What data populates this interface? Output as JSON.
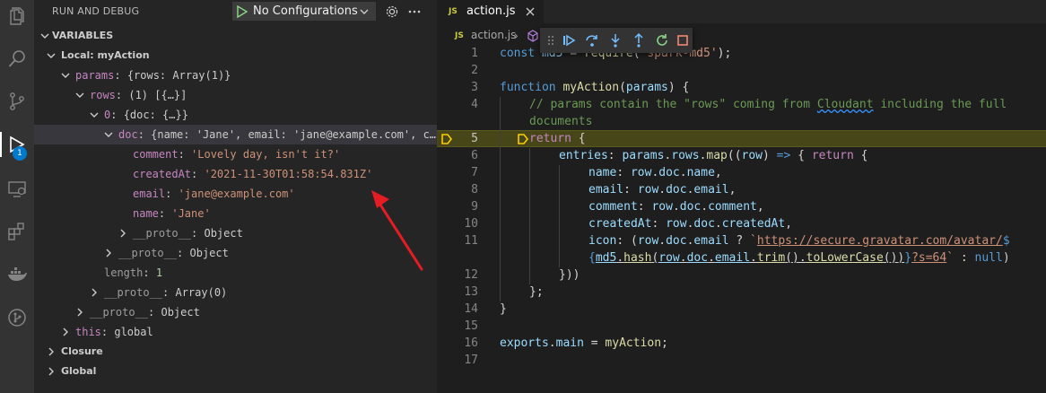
{
  "run_debug": {
    "title": "RUN AND DEBUG",
    "config_label": "No Configurations",
    "debug_badge": "1"
  },
  "variables": {
    "section_label": "VARIABLES",
    "scope_local": "Local: myAction",
    "rows": [
      {
        "name": "params",
        "sep": ": ",
        "value": "{rows: Array(1)}",
        "kind": "object"
      },
      {
        "name": "rows",
        "sep": ": ",
        "value": "(1) [{…}]",
        "kind": "object"
      },
      {
        "name": "0",
        "sep": ": ",
        "value": "{doc: {…}}",
        "kind": "object"
      },
      {
        "name": "doc",
        "sep": ": ",
        "value": "{name: 'Jane', email: 'jane@example.com', c…",
        "kind": "object"
      },
      {
        "name": "comment",
        "sep": ": ",
        "value": "'Lovely day, isn't it?'",
        "kind": "string"
      },
      {
        "name": "createdAt",
        "sep": ": ",
        "value": "'2021-11-30T01:58:54.831Z'",
        "kind": "string"
      },
      {
        "name": "email",
        "sep": ": ",
        "value": "'jane@example.com'",
        "kind": "string"
      },
      {
        "name": "name",
        "sep": ": ",
        "value": "'Jane'",
        "kind": "string"
      },
      {
        "name": "__proto__",
        "sep": ": ",
        "value": "Object",
        "kind": "object"
      },
      {
        "name": "__proto__",
        "sep": ": ",
        "value": "Object",
        "kind": "object"
      },
      {
        "name": "length",
        "sep": ": ",
        "value": "1",
        "kind": "number"
      },
      {
        "name": "__proto__",
        "sep": ": ",
        "value": "Array(0)",
        "kind": "object"
      },
      {
        "name": "__proto__",
        "sep": ": ",
        "value": "Object",
        "kind": "object"
      },
      {
        "name": "this",
        "sep": ": ",
        "value": "global",
        "kind": "object"
      }
    ],
    "scope_closure": "Closure",
    "scope_global": "Global"
  },
  "editor": {
    "tab_label": "action.js",
    "tab_badge": "JS",
    "breadcrumb_file": "action.js",
    "breadcrumb_sep": "›",
    "current_line": 5,
    "line_numbers": [
      "1",
      "2",
      "3",
      "4",
      "",
      "5",
      "6",
      "7",
      "8",
      "9",
      "10",
      "11",
      "",
      "12",
      "13",
      "14",
      "15",
      "16",
      "17"
    ],
    "code": {
      "l1a": "const ",
      "l1b": "md5",
      "l1c": " = ",
      "l1d": "require",
      "l1e": "(",
      "l1f": "'spark-md5'",
      "l1g": ");",
      "l3a": "function ",
      "l3b": "myAction",
      "l3c": "(",
      "l3d": "params",
      "l3e": ") {",
      "l4a": "// params contain the \"rows\" coming from ",
      "l4b": "Cloudant",
      "l4c": " including the full",
      "l4d": "documents",
      "l5a": "return",
      "l5b": " {",
      "l6a": "entries",
      "l6b": ": ",
      "l6c": "params",
      "l6d": ".",
      "l6e": "rows",
      "l6f": ".",
      "l6g": "map",
      "l6h": "((",
      "l6i": "row",
      "l6j": ") ",
      "l6k": "=>",
      "l6l": " { ",
      "l6m": "return",
      "l6n": " {",
      "l7a": "name",
      "l7b": ": ",
      "l7c": "row",
      "l7d": ".",
      "l7e": "doc",
      "l7f": ".",
      "l7g": "name",
      "l7h": ",",
      "l8a": "email",
      "l8b": ": ",
      "l8c": "row",
      "l8d": ".",
      "l8e": "doc",
      "l8f": ".",
      "l8g": "email",
      "l8h": ",",
      "l9a": "comment",
      "l9b": ": ",
      "l9c": "row",
      "l9d": ".",
      "l9e": "doc",
      "l9f": ".",
      "l9g": "comment",
      "l9h": ",",
      "l10a": "createdAt",
      "l10b": ": ",
      "l10c": "row",
      "l10d": ".",
      "l10e": "doc",
      "l10f": ".",
      "l10g": "createdAt",
      "l10h": ",",
      "l11a": "icon",
      "l11b": ": (",
      "l11c": "row",
      "l11d": ".",
      "l11e": "doc",
      "l11f": ".",
      "l11g": "email",
      "l11h": " ? ",
      "l11i": "`",
      "l11j": "https://secure.gravatar.com/avatar/",
      "l11k": "$",
      "l11w1": "{",
      "l11w2": "md5",
      "l11w3": ".",
      "l11w4": "hash",
      "l11w5": "(",
      "l11w6": "row",
      "l11w7": ".",
      "l11w8": "doc",
      "l11w9": ".",
      "l11w10": "email",
      "l11w11": ".",
      "l11w12": "trim",
      "l11w13": "().",
      "l11w14": "toLowerCase",
      "l11w15": "())",
      "l11w16": "}",
      "l11w17": "?s=64",
      "l11w18": "`",
      "l11w19": " : ",
      "l11w20": "null",
      "l11w21": ")",
      "l12": "}))",
      "l13": "};",
      "l14": "}",
      "l16a": "exports",
      "l16b": ".",
      "l16c": "main",
      "l16d": " = ",
      "l16e": "myAction",
      "l16f": ";"
    }
  },
  "colors": {
    "accent": "#007acc",
    "annotation_arrow": "#e51c23",
    "current_line_highlight": "#4b4b18",
    "breakpoint_marker": "#ffcc00"
  },
  "icons": [
    "explorer-icon",
    "search-icon",
    "source-control-icon",
    "run-debug-icon",
    "remote-explorer-icon",
    "extensions-icon",
    "docker-icon",
    "git-graph-icon",
    "gear-icon",
    "more-icon",
    "play-icon",
    "chevron-down-icon",
    "chevron-right-icon",
    "close-icon",
    "cube-icon",
    "continue-icon",
    "step-over-icon",
    "step-into-icon",
    "step-out-icon",
    "restart-icon",
    "stop-icon",
    "drag-handle-icon",
    "debug-stack-frame-icon"
  ]
}
